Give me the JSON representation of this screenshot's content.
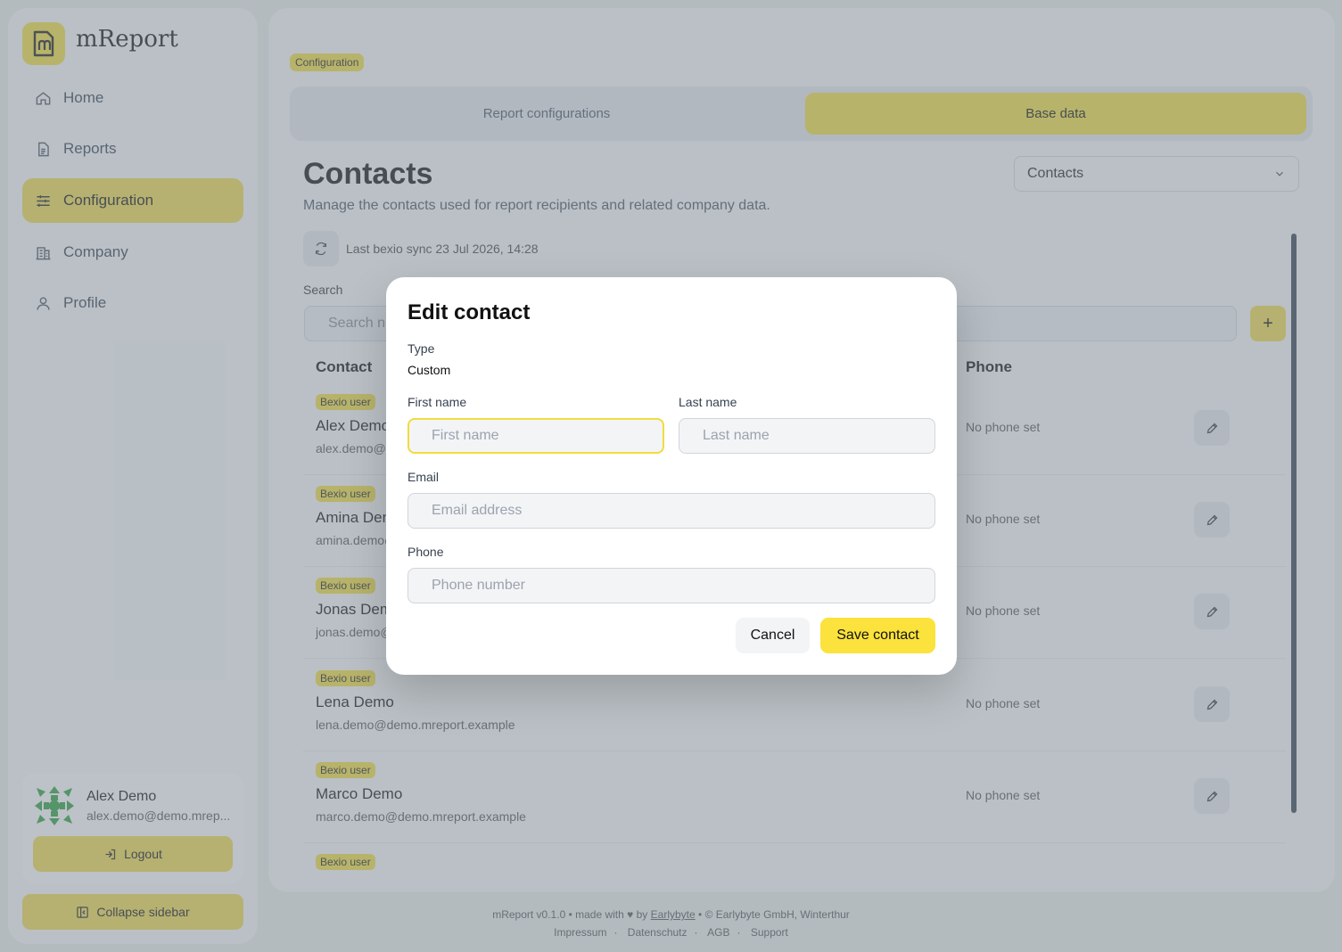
{
  "app": {
    "name": "mReport"
  },
  "sidebar": {
    "items": [
      {
        "label": "Home",
        "icon": "home-icon"
      },
      {
        "label": "Reports",
        "icon": "document-icon"
      },
      {
        "label": "Configuration",
        "icon": "sliders-icon",
        "active": true
      },
      {
        "label": "Company",
        "icon": "building-icon"
      },
      {
        "label": "Profile",
        "icon": "user-icon"
      }
    ],
    "user": {
      "name": "Alex Demo",
      "email": "alex.demo@demo.mrep..."
    },
    "logout_label": "Logout",
    "collapse_label": "Collapse sidebar"
  },
  "breadcrumb": "Configuration",
  "tabs": [
    {
      "label": "Report configurations",
      "active": false
    },
    {
      "label": "Base data",
      "active": true
    }
  ],
  "page": {
    "title": "Contacts",
    "subtitle": "Manage the contacts used for report recipients and related company data.",
    "select_value": "Contacts",
    "sync_text": "Last bexio sync 23 Jul 2026, 14:28",
    "search_label": "Search",
    "search_placeholder": "Search n",
    "add_label": "+"
  },
  "table": {
    "headers": {
      "contact": "Contact",
      "phone": "Phone"
    },
    "rows": [
      {
        "badge": "Bexio user",
        "name": "Alex Demo",
        "email": "alex.demo@demo.mreport.example",
        "phone": "No phone set"
      },
      {
        "badge": "Bexio user",
        "name": "Amina Demo",
        "email": "amina.demo@demo.mreport.example",
        "phone": "No phone set"
      },
      {
        "badge": "Bexio user",
        "name": "Jonas Demo",
        "email": "jonas.demo@demo.mreport.example",
        "phone": "No phone set"
      },
      {
        "badge": "Bexio user",
        "name": "Lena Demo",
        "email": "lena.demo@demo.mreport.example",
        "phone": "No phone set"
      },
      {
        "badge": "Bexio user",
        "name": "Marco Demo",
        "email": "marco.demo@demo.mreport.example",
        "phone": "No phone set"
      },
      {
        "badge": "Bexio user",
        "name": "",
        "email": "",
        "phone": ""
      }
    ]
  },
  "modal": {
    "title": "Edit contact",
    "type_label": "Type",
    "type_value": "Custom",
    "first_name_label": "First name",
    "first_name_placeholder": "First name",
    "last_name_label": "Last name",
    "last_name_placeholder": "Last name",
    "email_label": "Email",
    "email_placeholder": "Email address",
    "phone_label": "Phone",
    "phone_placeholder": "Phone number",
    "cancel_label": "Cancel",
    "save_label": "Save contact"
  },
  "footer": {
    "line1_prefix": "mReport v0.1.0 • made with",
    "heart": "♥",
    "by": "by",
    "author": "Earlybyte",
    "line1_suffix": "• © Earlybyte GmbH, Winterthur",
    "links": [
      "Impressum",
      "Datenschutz",
      "AGB",
      "Support"
    ]
  },
  "colors": {
    "accent": "#f1dc3e",
    "overlay": "#7d8a96"
  }
}
